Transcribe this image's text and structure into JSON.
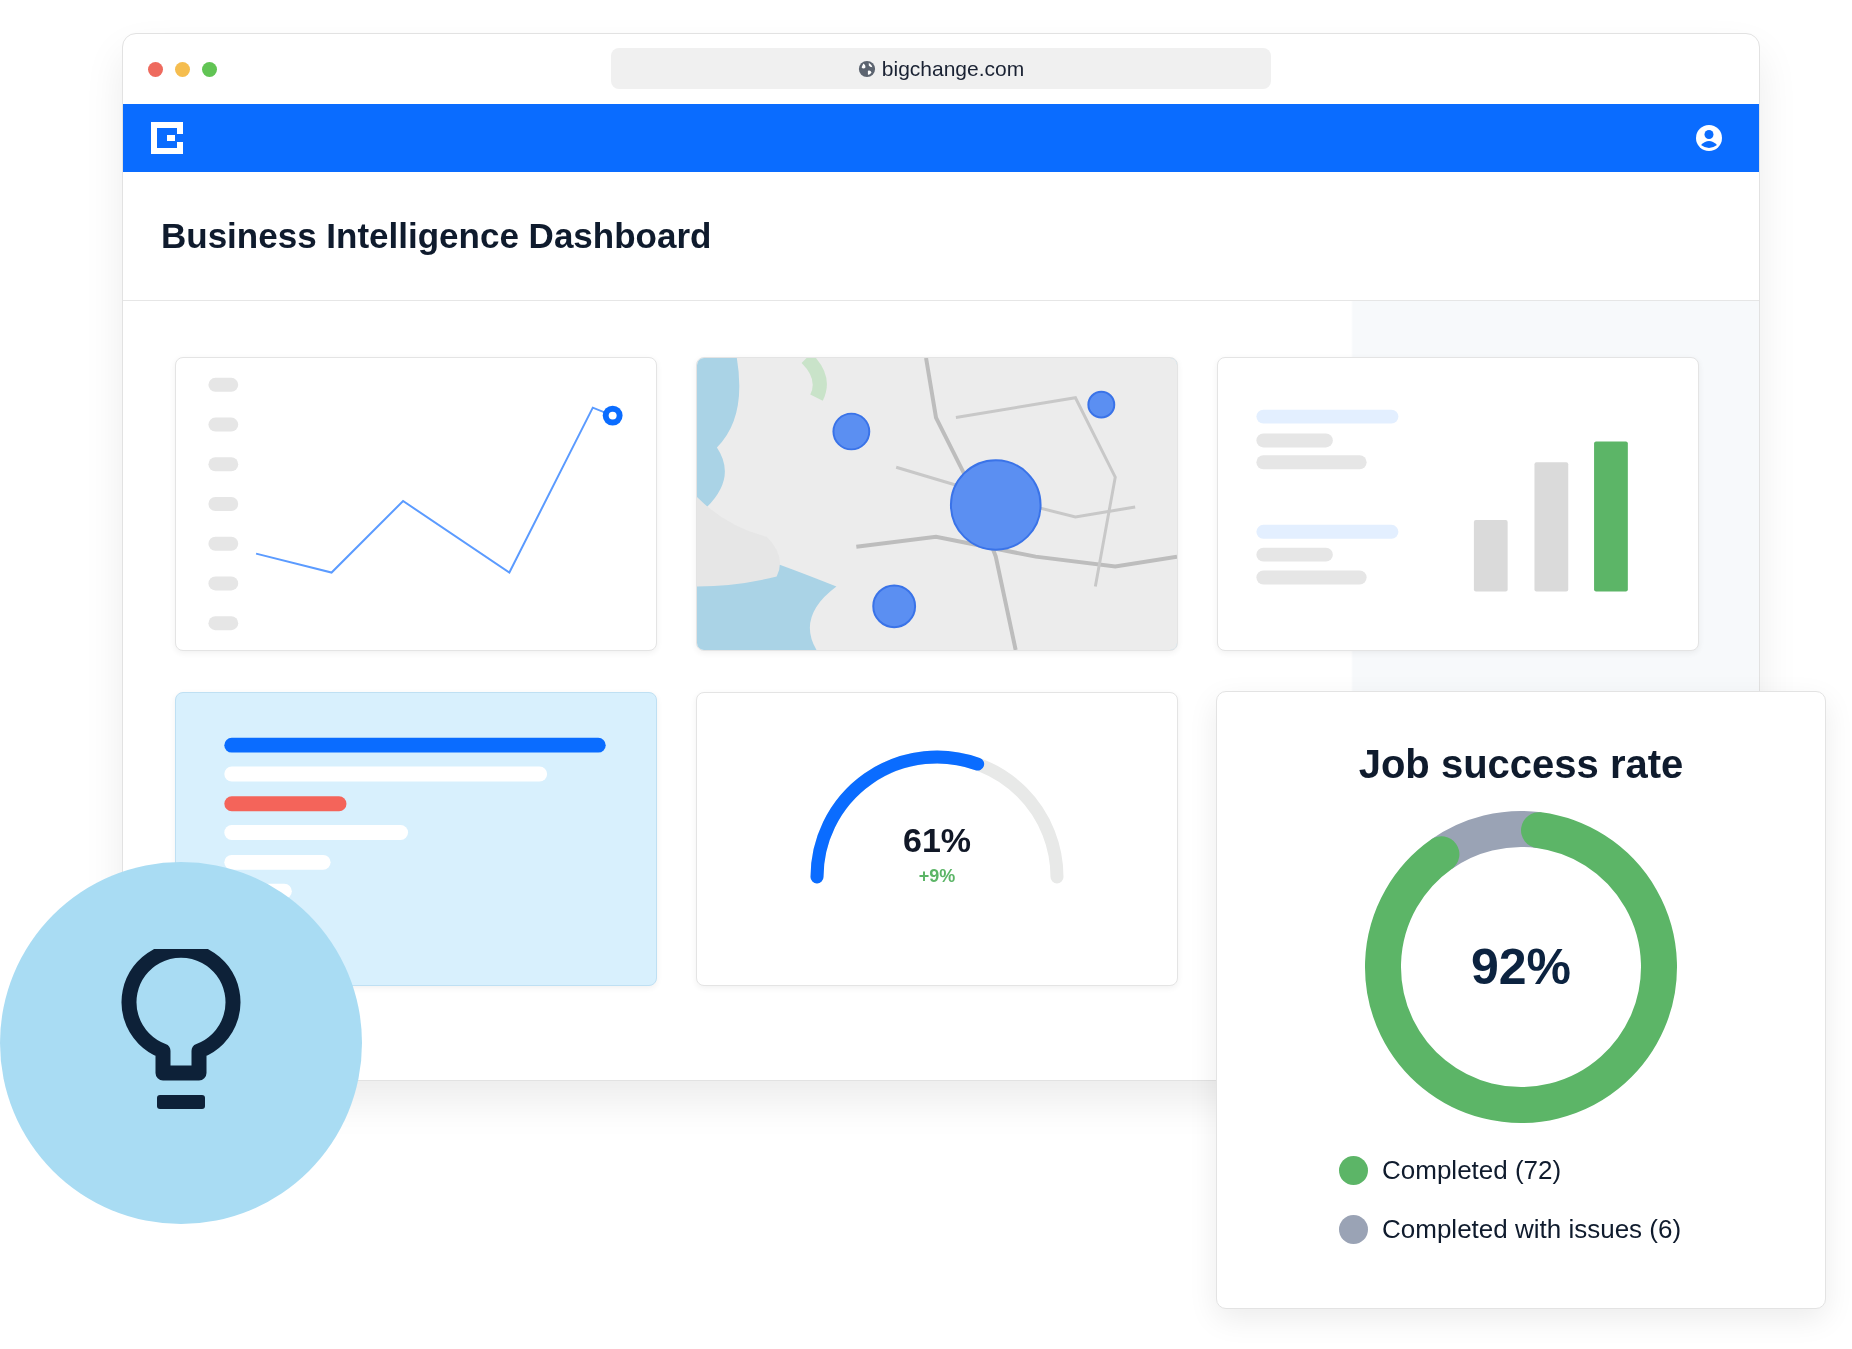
{
  "browser": {
    "url": "bigchange.com"
  },
  "page": {
    "title": "Business Intelligence Dashboard"
  },
  "gauge": {
    "value": "61%",
    "change": "+9%"
  },
  "job_success": {
    "title": "Job success rate",
    "center_label": "92%",
    "legend": [
      {
        "label": "Completed (72)",
        "color": "#5cb567"
      },
      {
        "label": "Completed with issues (6)",
        "color": "#9aa3b5"
      }
    ]
  }
}
